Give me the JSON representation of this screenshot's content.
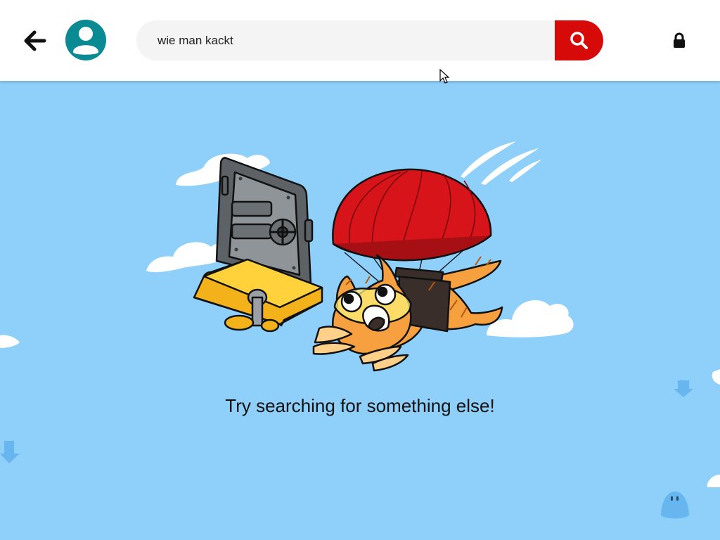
{
  "header": {
    "back_icon": "arrow-left-icon",
    "avatar_icon": "user-avatar-icon",
    "lock_icon": "lock-icon"
  },
  "search": {
    "query": "wie man kackt",
    "button_icon": "search-icon"
  },
  "main": {
    "message": "Try searching for something else!",
    "illustration": "parachuting-cat-and-vault"
  },
  "colors": {
    "header_bg": "#ffffff",
    "avatar": "#0a8a93",
    "search_field": "#f4f4f4",
    "search_button": "#d70a0a",
    "sky": "#8fd0fb",
    "parachute": "#d7141a"
  }
}
